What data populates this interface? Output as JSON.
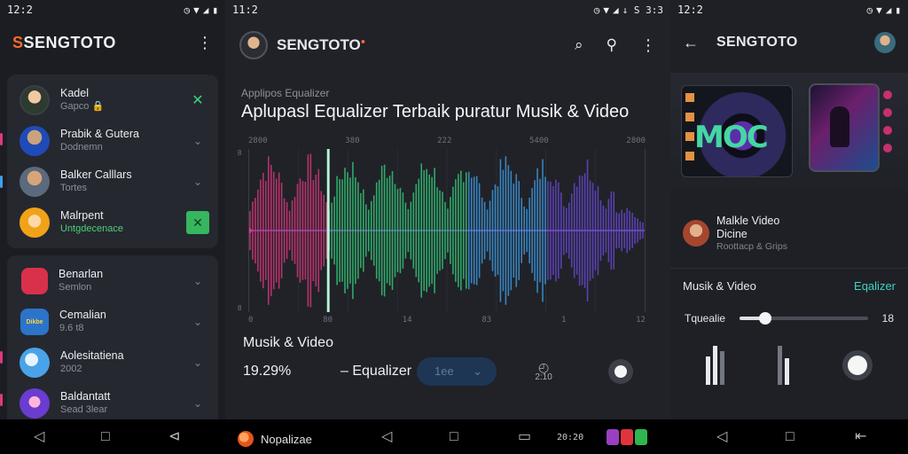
{
  "status": {
    "s1_time": "12:2",
    "s2_time": "11:2",
    "s2_right": "↓ S 3:3",
    "s3_time": "12:2"
  },
  "screen1": {
    "brand": "SENGTOTO",
    "top_chats": [
      {
        "name": "Kadel",
        "sub": "Gapco 🔒",
        "sub_green": false,
        "action": "✕"
      },
      {
        "name": "Prabik & Gutera",
        "sub": "Dodnemn",
        "sub_green": false,
        "action": "⌄"
      },
      {
        "name": "Balker Calllars",
        "sub": "Tortes",
        "sub_green": false,
        "action": "⌄"
      },
      {
        "name": "Malrpent",
        "sub": "Untgdecenace",
        "sub_green": true,
        "action": "✕"
      }
    ],
    "bottom_chats": [
      {
        "name": "Benarlan",
        "sub": "Semlon",
        "action": "⌄"
      },
      {
        "name": "Cemalian",
        "sub": "9.6 t8",
        "action": "⌄"
      },
      {
        "name": "Aolesitatiena",
        "sub": "2002",
        "action": "⌄"
      },
      {
        "name": "Baldantatt",
        "sub": "Sead 3lear",
        "action": "⌄"
      }
    ],
    "bottom_badge": "Dikbe"
  },
  "screen2": {
    "brand": "SENGTOTO",
    "kicker": "Applipos Equalizer",
    "headline": "Aplupasl Equalizer Terbaik puratur Musik & Video",
    "top_ticks": [
      "2800",
      "380",
      "222",
      "5400",
      "2800"
    ],
    "bottom_ticks": [
      "0",
      "80",
      "14",
      "83",
      "1",
      "12"
    ],
    "left_ticks": [
      "8",
      "8"
    ],
    "footer_title": "Musik & Video",
    "percent": "19.29%",
    "eq_label": "– Equalizer",
    "select_value": "1ee",
    "timer_text": "2:10"
  },
  "chart_data": {
    "type": "bar",
    "title": "",
    "series_colors": [
      "#e0387e",
      "#35d07a",
      "#3fa0e8",
      "#6a4ad6"
    ],
    "marker_position": 0.2,
    "midline": true
  },
  "screen3": {
    "title": "SENGTOTO",
    "thumb_text": "MOC",
    "item_title_1": "Malkle Video",
    "item_title_2": "Dicine",
    "item_sub": "Roottacp & Grips",
    "section_label": "Musik & Video",
    "section_link": "Eqalizer",
    "slider_label": "Tquealie",
    "slider_value": "18",
    "slider_level": 0.2
  },
  "navbar": {
    "app_label": "Nopalizae",
    "clock": "20:20"
  },
  "colors": {
    "accent_orange": "#ff6a2b",
    "accent_green": "#3ed07a",
    "accent_teal": "#3fd3c0"
  }
}
